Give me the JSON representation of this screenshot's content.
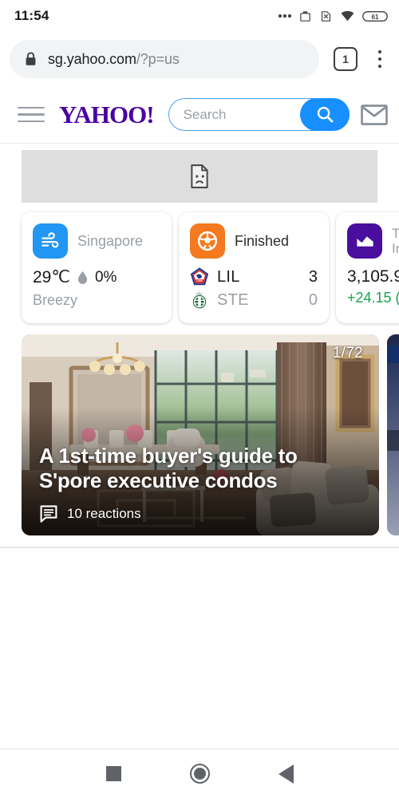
{
  "status_bar": {
    "time": "11:54",
    "icons": [
      "more-dots",
      "work-profile-briefcase",
      "no-sim-card",
      "wifi",
      "battery"
    ],
    "battery_level": "61"
  },
  "browser": {
    "omnibox": {
      "lock_icon": "lock-icon",
      "domain": "sg.yahoo.com",
      "path": "/?p=us",
      "full_url": "sg.yahoo.com/?p=us"
    },
    "tab_count": "1",
    "menu_icon": "kebab-menu-icon"
  },
  "site_header": {
    "menu_icon": "hamburger-menu-icon",
    "logo": "YAHOO!",
    "logo_color": "#4a00a0",
    "search": {
      "placeholder": "Search",
      "button_icon": "search-icon",
      "button_color": "#188fff"
    },
    "mail_icon": "mail-envelope-icon"
  },
  "broken_banner": {
    "icon": "broken-image-icon"
  },
  "cards": [
    {
      "type": "weather",
      "icon": "wind-icon",
      "icon_color": "#2196f3",
      "location": "Singapore",
      "temperature": "29℃",
      "precip_icon": "water-drop-icon",
      "precipitation": "0%",
      "condition": "Breezy"
    },
    {
      "type": "sports",
      "icon": "soccer-ball-icon",
      "icon_color": "#f47920",
      "status": "Finished",
      "teams": [
        {
          "crest": "losc-lille-crest",
          "code": "LIL",
          "score": "3",
          "result": "win"
        },
        {
          "crest": "saint-etienne-crest",
          "code": "STE",
          "score": "0",
          "result": "lose"
        }
      ]
    },
    {
      "type": "finance",
      "icon": "line-chart-icon",
      "icon_color": "#4a0e9e",
      "name_line1": "Ti",
      "name_line2": "In",
      "quote": "3,105.9",
      "change": "+24.15 (",
      "change_color": "#16a34a"
    }
  ],
  "carousel": {
    "counter": "1/72",
    "headline": "A 1st-time buyer's guide to S'pore executive condos",
    "reactions_icon": "comment-bubble-icon",
    "reactions": "10 reactions"
  },
  "nav_bar": {
    "recents_icon": "square-recents-icon",
    "home_icon": "circle-home-icon",
    "back_icon": "triangle-back-icon"
  }
}
